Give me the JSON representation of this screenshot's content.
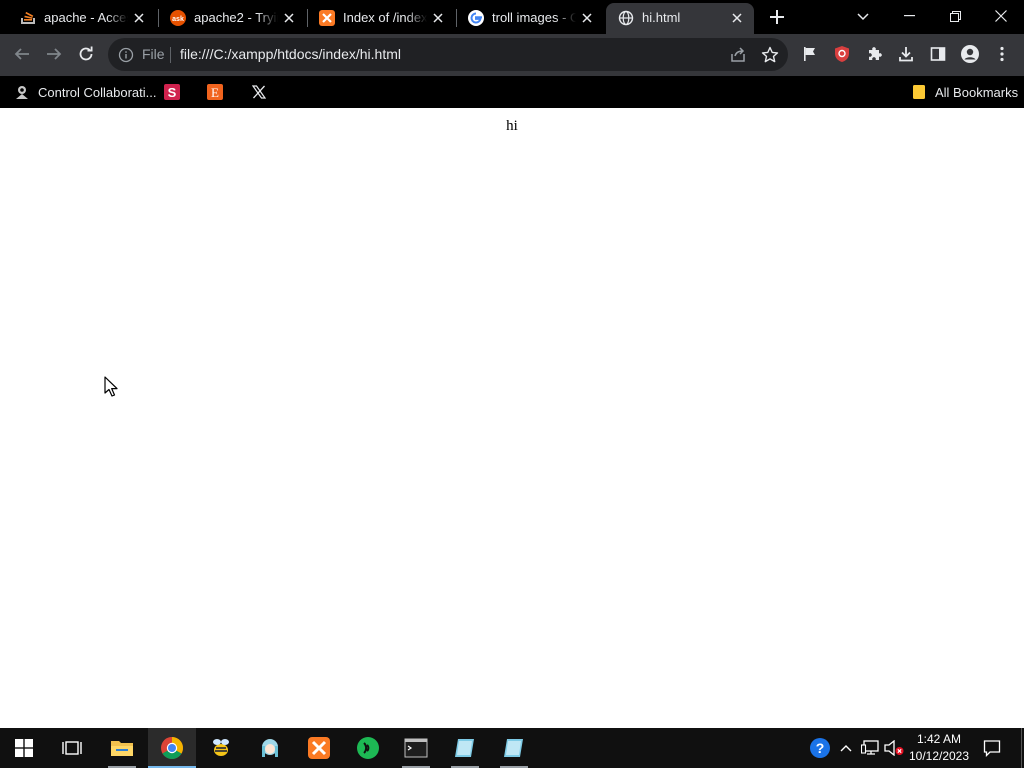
{
  "tabs": [
    {
      "title": "apache - Access",
      "icon": "stackoverflow-icon",
      "active": false
    },
    {
      "title": "apache2 - Trying",
      "icon": "askubuntu-icon",
      "active": false
    },
    {
      "title": "Index of /index",
      "icon": "xampp-icon",
      "active": false
    },
    {
      "title": "troll images - G",
      "icon": "google-icon",
      "active": false
    },
    {
      "title": "hi.html",
      "icon": "globe-icon",
      "active": true
    }
  ],
  "toolbar": {
    "scheme": "File",
    "url": "file:///C:/xampp/htdocs/index/hi.html"
  },
  "bookmarks": {
    "items": [
      {
        "label": "Control Collaborati...",
        "icon": "control-collaboration-icon"
      },
      {
        "label": "",
        "icon": "s-bookmark-icon"
      },
      {
        "label": "",
        "icon": "etsy-icon"
      },
      {
        "label": "",
        "icon": "x-icon"
      }
    ],
    "all_bookmarks": "All Bookmarks"
  },
  "page": {
    "text": "hi"
  },
  "taskbar": {
    "time": "1:42 AM",
    "date": "10/12/2023"
  },
  "colors": {
    "titlebar": "#000000",
    "toolbar": "#35363a",
    "omnibox": "#202124",
    "page": "#ffffff",
    "taskbar": "#101010",
    "active_indicator": "#76b9ed"
  }
}
